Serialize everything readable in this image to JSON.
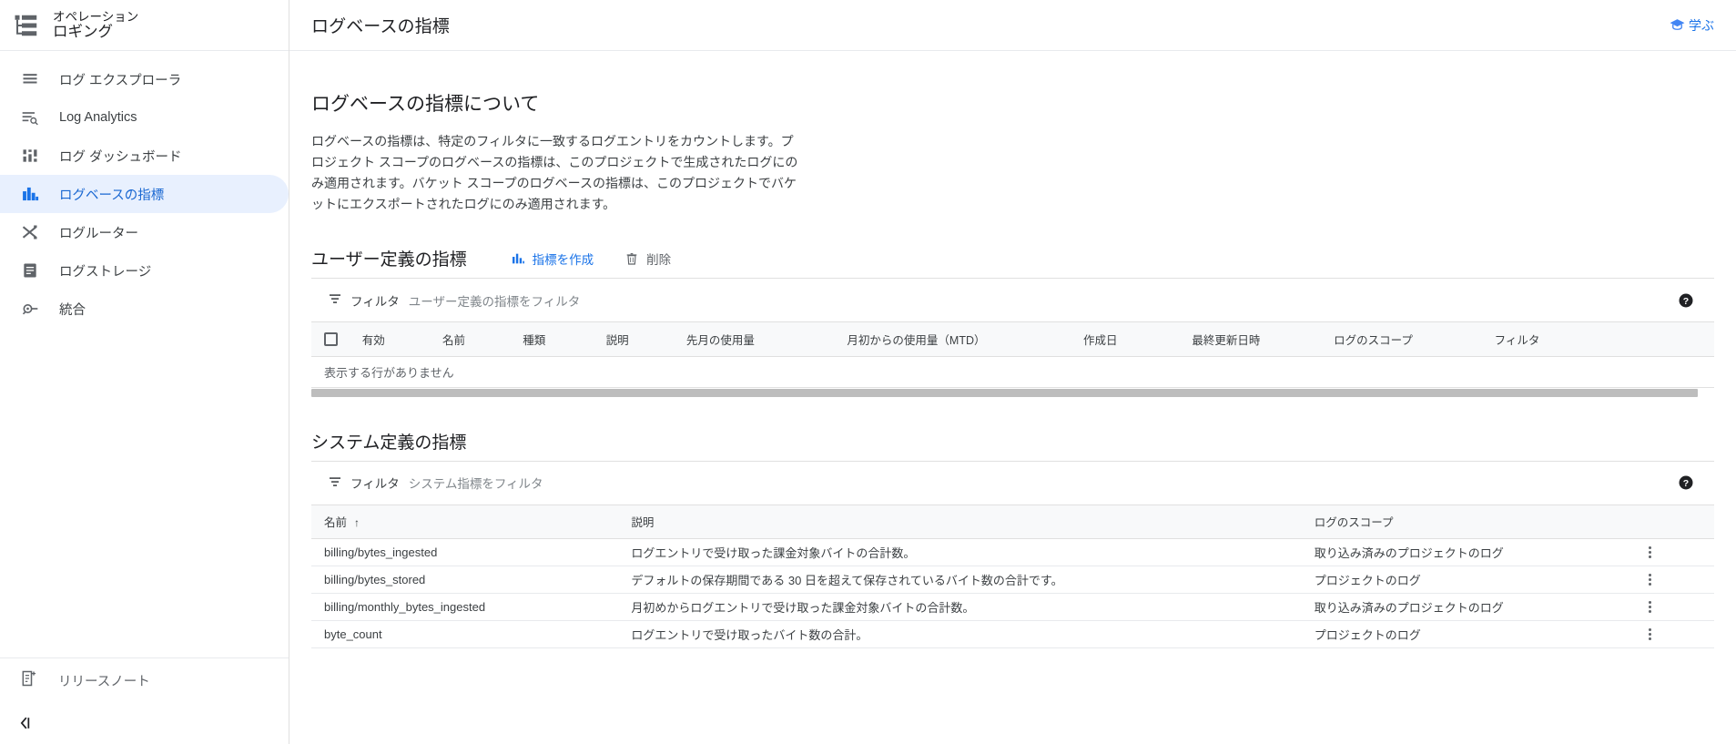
{
  "sidebar": {
    "product": {
      "eyebrow": "オペレーション",
      "name": "ロギング",
      "icon": "logging-product-icon"
    },
    "items": [
      {
        "label": "ログ エクスプローラ",
        "icon": "log-explorer-icon",
        "active": false
      },
      {
        "label": "Log Analytics",
        "icon": "log-analytics-icon",
        "active": false
      },
      {
        "label": "ログ ダッシュボード",
        "icon": "log-dashboard-icon",
        "active": false
      },
      {
        "label": "ログベースの指標",
        "icon": "logs-based-metrics-icon",
        "active": true
      },
      {
        "label": "ログルーター",
        "icon": "log-router-icon",
        "active": false
      },
      {
        "label": "ログストレージ",
        "icon": "log-storage-icon",
        "active": false
      },
      {
        "label": "統合",
        "icon": "integrations-icon",
        "active": false
      }
    ],
    "release_notes": {
      "label": "リリースノート",
      "icon": "release-notes-icon"
    },
    "collapse": {
      "icon": "collapse-panel-icon"
    }
  },
  "topbar": {
    "title": "ログベースの指標",
    "learn": {
      "label": "学ぶ",
      "icon": "graduation-cap-icon"
    }
  },
  "about": {
    "title": "ログベースの指標について",
    "body": "ログベースの指標は、特定のフィルタに一致するログエントリをカウントします。プロジェクト スコープのログベースの指標は、このプロジェクトで生成されたログにのみ適用されます。バケット スコープのログベースの指標は、このプロジェクトでバケットにエクスポートされたログにのみ適用されます。"
  },
  "user_metrics": {
    "title": "ユーザー定義の指標",
    "create_button": "指標を作成",
    "delete_button": "削除",
    "filter": {
      "label": "フィルタ",
      "placeholder": "ユーザー定義の指標をフィルタ",
      "icon": "filter-icon"
    },
    "help": {
      "icon": "help-icon"
    },
    "columns": [
      "有効",
      "名前",
      "種類",
      "説明",
      "先月の使用量",
      "月初からの使用量（MTD）",
      "作成日",
      "最終更新日時",
      "ログのスコープ",
      "フィルタ"
    ],
    "empty_text": "表示する行がありません"
  },
  "system_metrics": {
    "title": "システム定義の指標",
    "filter": {
      "label": "フィルタ",
      "placeholder": "システム指標をフィルタ",
      "icon": "filter-icon"
    },
    "help": {
      "icon": "help-icon"
    },
    "columns": {
      "name": "名前",
      "description": "説明",
      "scope": "ログのスコープ"
    },
    "sort": {
      "column": "名前",
      "direction": "asc",
      "arrow": "↑"
    },
    "rows": [
      {
        "name": "billing/bytes_ingested",
        "description": "ログエントリで受け取った課金対象バイトの合計数。",
        "scope": "取り込み済みのプロジェクトのログ"
      },
      {
        "name": "billing/bytes_stored",
        "description": "デフォルトの保存期間である 30 日を超えて保存されているバイト数の合計です。",
        "scope": "プロジェクトのログ"
      },
      {
        "name": "billing/monthly_bytes_ingested",
        "description": "月初めからログエントリで受け取った課金対象バイトの合計数。",
        "scope": "取り込み済みのプロジェクトのログ"
      },
      {
        "name": "byte_count",
        "description": "ログエントリで受け取ったバイト数の合計。",
        "scope": "プロジェクトのログ"
      }
    ]
  },
  "colors": {
    "accent": "#1a73e8",
    "active_nav_bg": "#e8f0fe",
    "active_nav_text": "#1967d2",
    "header_bg": "#f8f9fa",
    "border": "#e0e0e0",
    "muted_text": "#5f6368"
  }
}
